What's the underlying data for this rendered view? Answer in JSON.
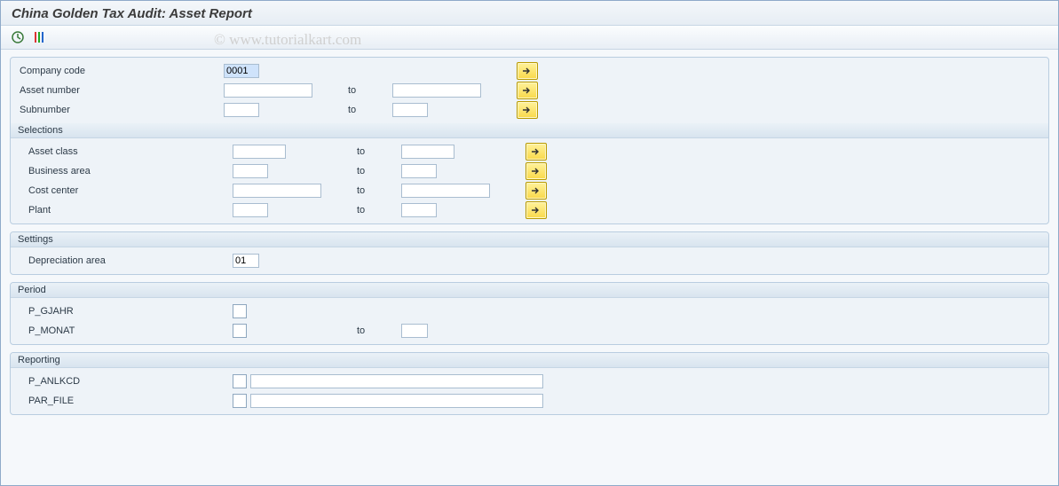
{
  "title": "China Golden Tax Audit: Asset Report",
  "watermark": "© www.tutorialkart.com",
  "toolbar": {
    "execute_icon": "execute",
    "variant_icon": "variant"
  },
  "top": {
    "company_code": {
      "label": "Company code",
      "value": "0001"
    },
    "asset_number": {
      "label": "Asset number",
      "to": "to",
      "from_value": "",
      "to_value": ""
    },
    "subnumber": {
      "label": "Subnumber",
      "to": "to",
      "from_value": "",
      "to_value": ""
    }
  },
  "selections": {
    "title": "Selections",
    "rows": [
      {
        "label": "Asset class",
        "to": "to",
        "from_value": "",
        "to_value": ""
      },
      {
        "label": "Business area",
        "to": "to",
        "from_value": "",
        "to_value": ""
      },
      {
        "label": "Cost center",
        "to": "to",
        "from_value": "",
        "to_value": ""
      },
      {
        "label": "Plant",
        "to": "to",
        "from_value": "",
        "to_value": ""
      }
    ]
  },
  "settings": {
    "title": "Settings",
    "depreciation_area": {
      "label": "Depreciation area",
      "value": "01"
    }
  },
  "period": {
    "title": "Period",
    "p_gjahr": {
      "label": "P_GJAHR",
      "value": ""
    },
    "p_monat": {
      "label": "P_MONAT",
      "to": "to",
      "from_value": "",
      "to_value": ""
    }
  },
  "reporting": {
    "title": "Reporting",
    "p_anlkcd": {
      "label": "P_ANLKCD",
      "value": ""
    },
    "par_file": {
      "label": "PAR_FILE",
      "value": ""
    }
  }
}
